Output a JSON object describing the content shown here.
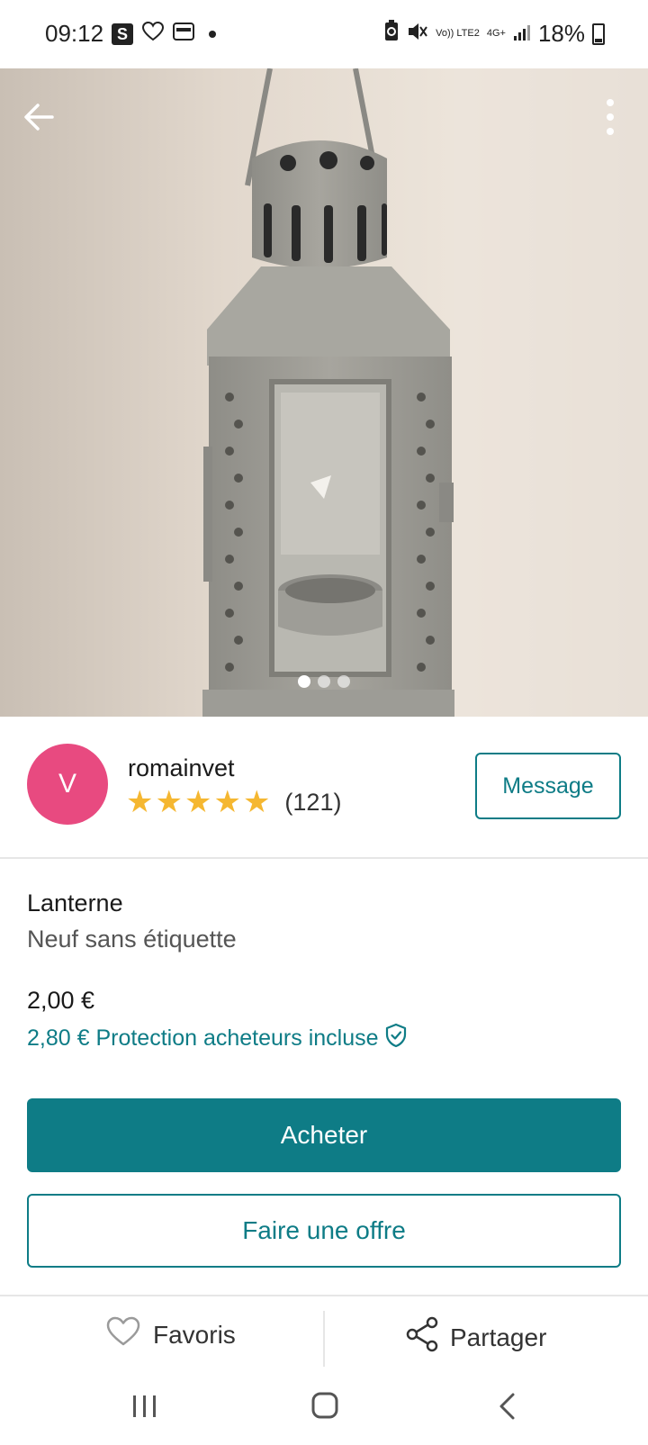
{
  "status_bar": {
    "time": "09:12",
    "s_badge": "S",
    "network_top": "Vo)) LTE2",
    "network_mid": "4G+",
    "battery_percent": "18%"
  },
  "listing": {
    "photo_count": 3,
    "active_photo_index": 0,
    "seller": {
      "avatar_letter": "V",
      "avatar_color": "#e84a80",
      "username": "romainvet",
      "rating_stars": 5,
      "rating_count": "(121)",
      "message_label": "Message"
    },
    "title": "Lanterne",
    "condition": "Neuf sans étiquette",
    "price": "2,00 €",
    "protection_text": "2,80 € Protection acheteurs incluse",
    "buy_label": "Acheter",
    "offer_label": "Faire une offre"
  },
  "actions": {
    "favorite_label": "Favoris",
    "share_label": "Partager"
  },
  "colors": {
    "accent": "#0e7c86",
    "star": "#f5b731"
  },
  "icons": {
    "back": "arrow-left-icon",
    "more": "more-vertical-icon",
    "shield": "shield-check-icon",
    "heart": "heart-outline-icon",
    "share": "share-icon"
  }
}
